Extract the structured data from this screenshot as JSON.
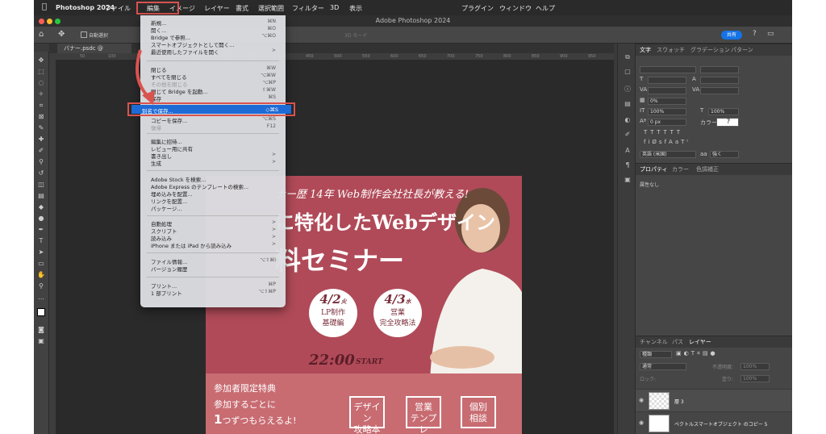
{
  "menubar": {
    "apple": "",
    "app_name": "Photoshop 2024",
    "items": [
      "ファイル",
      "編集",
      "イメージ",
      "レイヤー",
      "書式",
      "選択範囲",
      "フィルター",
      "3D",
      "表示"
    ],
    "right_items": [
      "プラグイン",
      "ウィンドウ",
      "ヘルプ"
    ]
  },
  "window": {
    "title": "Adobe Photoshop 2024"
  },
  "options_bar": {
    "auto_select": "自動選択",
    "mode_3d": "3D モード",
    "share": "共有"
  },
  "document": {
    "tab": "バナー.psdc @"
  },
  "ruler": {
    "ticks": [
      "50",
      "100",
      "150",
      "200",
      "250",
      "300",
      "350",
      "400",
      "450",
      "500",
      "550",
      "600",
      "650",
      "700",
      "750",
      "800",
      "850",
      "900",
      "950"
    ]
  },
  "file_menu": {
    "rows": [
      {
        "label": "新規...",
        "shortcut": "⌘N",
        "disabled": false
      },
      {
        "label": "開く...",
        "shortcut": "⌘O",
        "disabled": false
      },
      {
        "label": "Bridge で参照...",
        "shortcut": "⌥⌘O",
        "disabled": false
      },
      {
        "label": "スマートオブジェクトとして開く...",
        "shortcut": "",
        "disabled": false
      },
      {
        "label": "最近使用したファイルを開く",
        "shortcut": ">",
        "disabled": false
      },
      {
        "label": "閉じる",
        "shortcut": "⌘W",
        "disabled": false
      },
      {
        "label": "すべてを閉じる",
        "shortcut": "⌥⌘W",
        "disabled": false
      },
      {
        "label": "その他を閉じる",
        "shortcut": "⌥⌘P",
        "disabled": true
      },
      {
        "label": "閉じて Bridge を起動...",
        "shortcut": "⇧⌘W",
        "disabled": false
      },
      {
        "label": "保存",
        "shortcut": "⌘S",
        "disabled": false
      },
      {
        "label": "別名で保存...",
        "shortcut": "⇧⌘S",
        "disabled": false
      },
      {
        "label": "コピーを保存...",
        "shortcut": "⌥⌘S",
        "disabled": false
      },
      {
        "label": "復帰",
        "shortcut": "F12",
        "disabled": true
      },
      {
        "label": "編集に招待...",
        "shortcut": "",
        "disabled": false
      },
      {
        "label": "レビュー用に共有",
        "shortcut": "",
        "disabled": false
      },
      {
        "label": "書き出し",
        "shortcut": ">",
        "disabled": false
      },
      {
        "label": "生成",
        "shortcut": ">",
        "disabled": false
      },
      {
        "label": "Adobe Stock を検索...",
        "shortcut": "",
        "disabled": false
      },
      {
        "label": "Adobe Express のテンプレートの検索...",
        "shortcut": "",
        "disabled": false
      },
      {
        "label": "埋め込みを配置...",
        "shortcut": "",
        "disabled": false
      },
      {
        "label": "リンクを配置...",
        "shortcut": "",
        "disabled": false
      },
      {
        "label": "パッケージ...",
        "shortcut": "",
        "disabled": false
      },
      {
        "label": "自動処理",
        "shortcut": ">",
        "disabled": false
      },
      {
        "label": "スクリプト",
        "shortcut": ">",
        "disabled": false
      },
      {
        "label": "読み込み",
        "shortcut": ">",
        "disabled": false
      },
      {
        "label": "iPhone または iPad から読み込み",
        "shortcut": ">",
        "disabled": false
      },
      {
        "label": "ファイル情報...",
        "shortcut": "⌥⇧⌘I",
        "disabled": false
      },
      {
        "label": "バージョン履歴",
        "shortcut": "",
        "disabled": false
      },
      {
        "label": "プリント...",
        "shortcut": "⌘P",
        "disabled": false
      },
      {
        "label": "1 部プリント",
        "shortcut": "⌥⇧⌘P",
        "disabled": false
      }
    ],
    "highlighted": {
      "label": "別名で保存...",
      "shortcut": "◇⌘S"
    }
  },
  "banner": {
    "top_line": "ナー歴  14年 Web制作会社社長が教える!",
    "headline1": "に特化したWebデザイン",
    "headline2": "料セミナー",
    "date1": "4/2",
    "date1_day": "火",
    "date1_topic_a": "LP制作",
    "date1_topic_b": "基礎編",
    "date2": "4/3",
    "date2_day": "水",
    "date2_topic_a": "営業",
    "date2_topic_b": "完全攻略法",
    "time": "22:00",
    "time_label": "START",
    "perk_title": "参加者限定特典",
    "perk_line1": "参加するごとに",
    "perk_line2_num": "1",
    "perk_line2": "つずつもらえるよ!",
    "gift1_a": "デザイン",
    "gift1_b": "攻略本",
    "gift2_a": "営業",
    "gift2_b": "テンプレ",
    "gift3_a": "個別",
    "gift3_b": "相談"
  },
  "panel": {
    "char_tabs": [
      "文字",
      "スウォッチ",
      "グラデーション",
      "パターン"
    ],
    "size_scale_v": "100%",
    "size_scale_h": "100%",
    "tracking": "0%",
    "baseline": "0 px",
    "color_label": "カラー:",
    "color_value": "?",
    "language": "英語 (米国)",
    "aa": "aa",
    "aa_mode": "強く",
    "prop_tabs": [
      "プロパティ",
      "カラー",
      "色調補正"
    ],
    "prop_none": "属性なし",
    "layer_tabs": [
      "チャンネル",
      "パス",
      "レイヤー"
    ],
    "layer_kind": "種類",
    "blend_mode": "通常",
    "opacity_label": "不透明度:",
    "opacity": "100%",
    "lock_label": "ロック:",
    "fill_label": "塗り:",
    "fill": "100%",
    "layers": [
      {
        "name": "層 3"
      },
      {
        "name": "ベクトルスマートオブジェクト のコピー 5"
      }
    ]
  }
}
